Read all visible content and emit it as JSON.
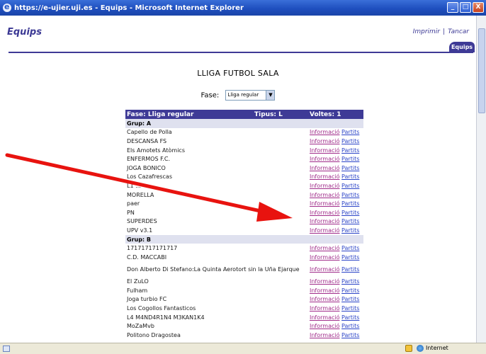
{
  "window": {
    "title": "https://e-ujier.uji.es - Equips - Microsoft Internet Explorer",
    "buttons": [
      "_",
      "□",
      "X"
    ]
  },
  "header": {
    "app_title": "Equips",
    "links": [
      "Imprimir",
      "Tancar"
    ],
    "link_separator": "|",
    "tab_label": "Equips"
  },
  "page": {
    "title": "LLIGA FUTBOL SALA",
    "fase_label": "Fase:",
    "fase_value": "Lliga regular"
  },
  "table": {
    "header": {
      "fase": "Fase: Lliga regular",
      "tipus": "Tipus: L",
      "voltes": "Voltes: 1"
    },
    "link_labels": {
      "info": "Informació",
      "matches": "Partits"
    },
    "groups": [
      {
        "label": "Grup: A",
        "teams": [
          "Capello de Polla",
          "DESCANSA FS",
          "Els Amotets Atòmics",
          "ENFERMOS F.C.",
          "JOGA BONICO",
          "Los Cazafrescas",
          "L1 ...",
          "MORELLA",
          "paer",
          "PN",
          "SUPERDES",
          "UPV v3.1"
        ]
      },
      {
        "label": "Grup: B",
        "teams": [
          "17171717171717",
          "C.D. MACCABI",
          "Don Alberto Di Stefano:La Quinta Aerotort sin la Uña Ejarque",
          "El ZuLO",
          "Fulham",
          "Joga turbio FC",
          "Los Cogollos Fantasticos",
          "L4 M4ND4R1N4 M3KAN1K4",
          "MoZaMvb",
          "Politono Dragostea"
        ]
      }
    ]
  },
  "status": {
    "zone": "Internet"
  },
  "colors": {
    "accent": "#3e3a96",
    "arrow": "#e8130f",
    "link": "#2b44c7",
    "visited_link": "#a02c8a",
    "group_bg": "#dfe1ef"
  },
  "icons": [
    "ie-icon",
    "scroll-thumb",
    "lock-icon",
    "globe-icon",
    "page-icon"
  ]
}
